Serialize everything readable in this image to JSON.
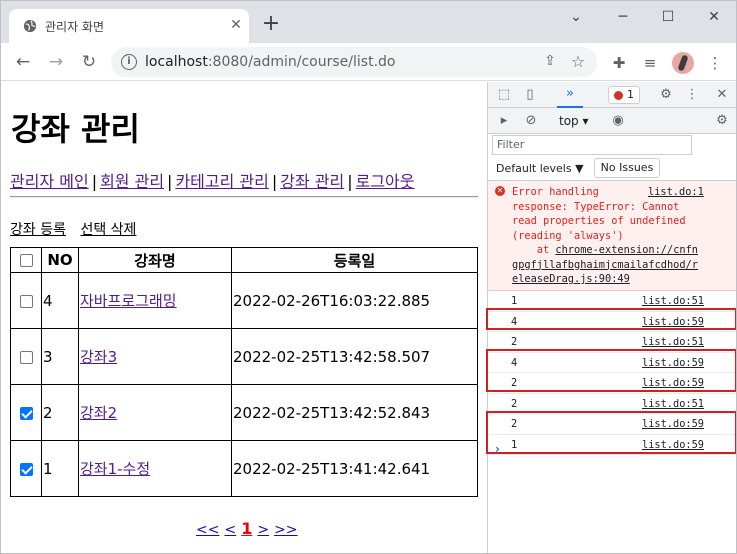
{
  "browser": {
    "tab_title": "관리자 화면",
    "tab_close": "✕",
    "new_tab": "+",
    "url_host": "localhost",
    "url_rest": ":8080/admin/course/list.do",
    "window": {
      "minimize": "─",
      "maximize": "☐",
      "close": "✕",
      "chevron": "⌄"
    }
  },
  "page": {
    "title": "강좌 관리",
    "menu": [
      {
        "label": "관리자 메인"
      },
      {
        "label": "회원 관리"
      },
      {
        "label": "카테고리 관리"
      },
      {
        "label": "강좌 관리"
      },
      {
        "label": "로그아웃"
      }
    ],
    "menu_separator": "|",
    "actions": {
      "register": "강좌 등록",
      "delete_selected": "선택 삭제"
    },
    "table": {
      "headers": {
        "no": "NO",
        "name": "강좌명",
        "date": "등록일"
      },
      "rows": [
        {
          "checked": false,
          "no": "4",
          "name": "자바프로그래밍",
          "date": "2022-02-26T16:03:22.885"
        },
        {
          "checked": false,
          "no": "3",
          "name": "강좌3",
          "date": "2022-02-25T13:42:58.507"
        },
        {
          "checked": true,
          "no": "2",
          "name": "강좌2",
          "date": "2022-02-25T13:42:52.843"
        },
        {
          "checked": true,
          "no": "1",
          "name": "강좌1-수정",
          "date": "2022-02-25T13:41:42.641"
        }
      ]
    },
    "pager": {
      "first": "<<",
      "prev": "<",
      "current": "1",
      "next": ">",
      "last": ">>"
    }
  },
  "devtools": {
    "tab_console": "»",
    "error_count": "1",
    "context": "top",
    "filter_placeholder": "Filter",
    "default_levels": "Default levels ▼",
    "no_issues": "No Issues",
    "error": {
      "source": "list.do:1",
      "lines": [
        "Error handling",
        "response: TypeError: Cannot",
        "read properties of undefined",
        "(reading 'always')"
      ],
      "at_prefix": "    at ",
      "trace_1": "chrome-extension://cnfn",
      "trace_2": "gpgfjllafbghaimjcmailafcdhod/r",
      "trace_3": "eleaseDrag.js:90:49"
    },
    "logs": [
      {
        "value": "1",
        "source": "list.do:51"
      },
      {
        "value": "4",
        "source": "list.do:59"
      },
      {
        "value": "2",
        "source": "list.do:51"
      },
      {
        "value": "4",
        "source": "list.do:59"
      },
      {
        "value": "2",
        "source": "list.do:59"
      },
      {
        "value": "2",
        "source": "list.do:51"
      },
      {
        "value": "2",
        "source": "list.do:59"
      },
      {
        "value": "1",
        "source": "list.do:59"
      }
    ],
    "prompt": "›",
    "highlight_color": "#d0201f"
  }
}
